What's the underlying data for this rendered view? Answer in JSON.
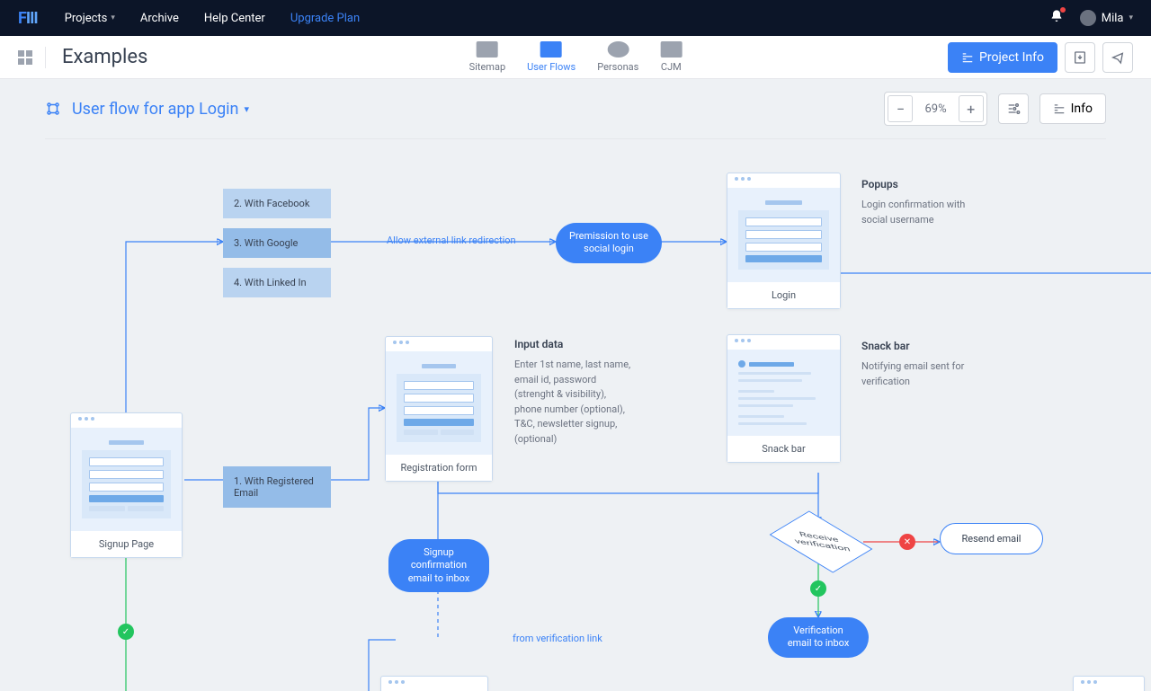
{
  "nav": {
    "projects": "Projects",
    "archive": "Archive",
    "help": "Help Center",
    "upgrade": "Upgrade Plan",
    "user": "Mila"
  },
  "subnav": {
    "title": "Examples"
  },
  "tabs": {
    "sitemap": "Sitemap",
    "userflows": "User Flows",
    "personas": "Personas",
    "cjm": "CJM"
  },
  "subright": {
    "projectinfo": "Project Info"
  },
  "toolbar": {
    "flowtitle": "User flow for app Login",
    "zoom": "69%",
    "info": "Info"
  },
  "options": {
    "o1": "1. With Registered Email",
    "o2": "2. With Facebook",
    "o3": "3. With Google",
    "o4": "4. With Linked In"
  },
  "labels": {
    "allow": "Allow external link redirection",
    "permission": "Premission to use social login",
    "signup": "Signup Page",
    "login": "Login",
    "regform": "Registration form",
    "snackbar": "Snack bar",
    "popups_h": "Popups",
    "popups_t": "Login confirmation with social username",
    "snack_h": "Snack bar",
    "snack_t": "Notifying email sent for verification",
    "input_h": "Input data",
    "input_t": "Enter 1st name, last name, email id, password (strenght & visibility), phone number (optional), T&C, newsletter signup, (optional)",
    "signup_conf": "Signup confirmation email to inbox",
    "from_link": "from verification link",
    "receive": "Receive verification",
    "resend": "Resend email",
    "verif_email": "Verification email to inbox"
  }
}
